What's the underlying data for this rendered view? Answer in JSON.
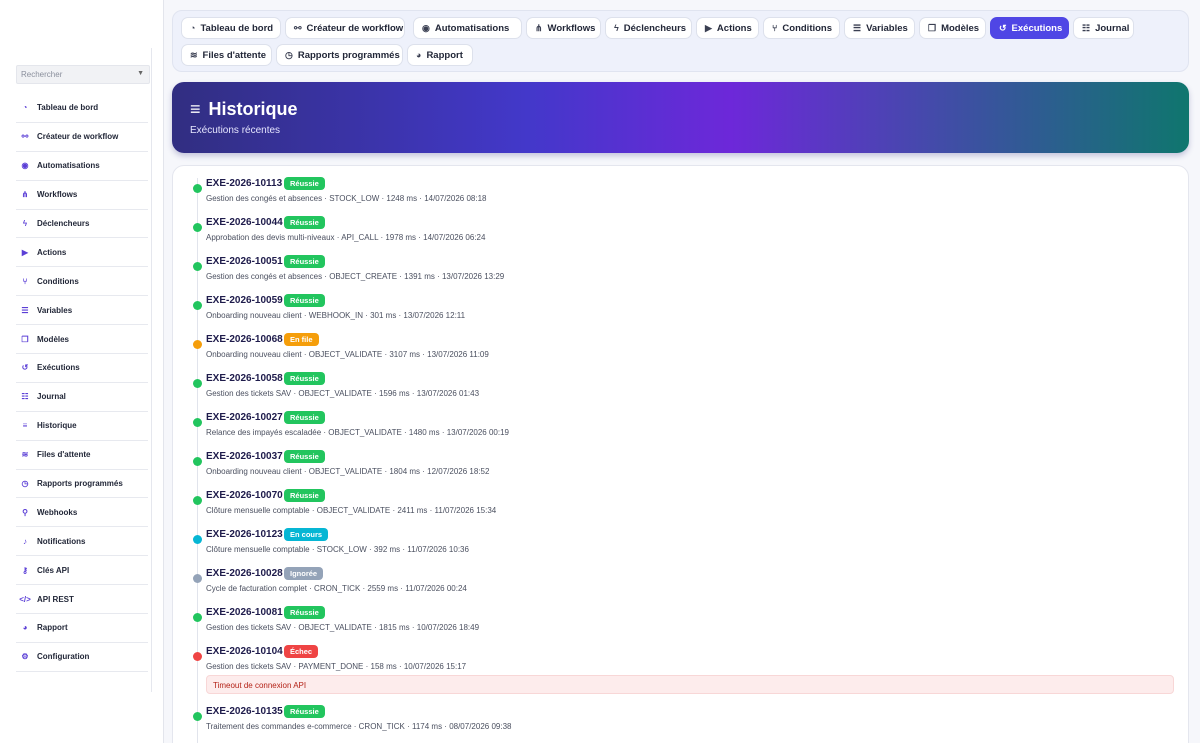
{
  "sidebar": {
    "search_placeholder": "Rechercher",
    "items": [
      {
        "label": "Tableau de bord",
        "icon": "gauge-icon",
        "glyph": "◔"
      },
      {
        "label": "Créateur de workflow",
        "icon": "flow-icon",
        "glyph": "⚯"
      },
      {
        "label": "Automatisations",
        "icon": "robot-icon",
        "glyph": "◉"
      },
      {
        "label": "Workflows",
        "icon": "sitemap-icon",
        "glyph": "⋔"
      },
      {
        "label": "Déclencheurs",
        "icon": "bolt-icon",
        "glyph": "ϟ"
      },
      {
        "label": "Actions",
        "icon": "play-icon",
        "glyph": "▶"
      },
      {
        "label": "Conditions",
        "icon": "branch-icon",
        "glyph": "⑂"
      },
      {
        "label": "Variables",
        "icon": "sliders-icon",
        "glyph": "☰"
      },
      {
        "label": "Modèles",
        "icon": "copy-icon",
        "glyph": "❐"
      },
      {
        "label": "Exécutions",
        "icon": "history-icon",
        "glyph": "↺"
      },
      {
        "label": "Journal",
        "icon": "list-icon",
        "glyph": "☷"
      },
      {
        "label": "Historique",
        "icon": "bars-icon",
        "glyph": "≡"
      },
      {
        "label": "Files d'attente",
        "icon": "layers-icon",
        "glyph": "≋"
      },
      {
        "label": "Rapports programmés",
        "icon": "clock-icon",
        "glyph": "◷"
      },
      {
        "label": "Webhooks",
        "icon": "webhook-icon",
        "glyph": "⚲"
      },
      {
        "label": "Notifications",
        "icon": "bell-icon",
        "glyph": "♪"
      },
      {
        "label": "Clés API",
        "icon": "key-icon",
        "glyph": "⚷"
      },
      {
        "label": "API REST",
        "icon": "code-icon",
        "glyph": "</>"
      },
      {
        "label": "Rapport",
        "icon": "chart-pie-icon",
        "glyph": "◕"
      },
      {
        "label": "Configuration",
        "icon": "gear-icon",
        "glyph": "⚙"
      }
    ]
  },
  "topnav": {
    "row1": [
      {
        "label": "Tableau de bord",
        "icon": "gauge-icon",
        "glyph": "◔",
        "active": false
      },
      {
        "label": "Créateur de workflow",
        "icon": "flow-icon",
        "glyph": "⚯",
        "active": false
      },
      {
        "label": "Automatisations",
        "icon": "robot-icon",
        "glyph": "◉",
        "active": false
      },
      {
        "label": "Workflows",
        "icon": "sitemap-icon",
        "glyph": "⋔",
        "active": false
      },
      {
        "label": "Déclencheurs",
        "icon": "bolt-icon",
        "glyph": "ϟ",
        "active": false
      },
      {
        "label": "Actions",
        "icon": "play-icon",
        "glyph": "▶",
        "active": false
      },
      {
        "label": "Conditions",
        "icon": "branch-icon",
        "glyph": "⑂",
        "active": false
      },
      {
        "label": "Variables",
        "icon": "sliders-icon",
        "glyph": "☰",
        "active": false
      },
      {
        "label": "Modèles",
        "icon": "copy-icon",
        "glyph": "❐",
        "active": false
      },
      {
        "label": "Exécutions",
        "icon": "history-icon",
        "glyph": "↺",
        "active": true
      },
      {
        "label": "Journal",
        "icon": "list-icon",
        "glyph": "☷",
        "active": false
      }
    ],
    "row2": [
      {
        "label": "Files d'attente",
        "icon": "layers-icon",
        "glyph": "≋",
        "active": false
      },
      {
        "label": "Rapports programmés",
        "icon": "clock-icon",
        "glyph": "◷",
        "active": false
      },
      {
        "label": "Rapport",
        "icon": "chart-pie-icon",
        "glyph": "◕",
        "active": false
      }
    ]
  },
  "hero": {
    "title": "Historique",
    "subtitle": "Exécutions récentes"
  },
  "status_colors": {
    "Réussie": "#22c55e",
    "En file": "#f59e0b",
    "En cours": "#06b6d4",
    "Ignorée": "#94a3b8",
    "Échec": "#ef4444"
  },
  "executions": [
    {
      "id": "EXE-2026-10113",
      "status": "Réussie",
      "workflow": "Gestion des congés et absences",
      "trigger": "STOCK_LOW",
      "duration": "1248 ms",
      "date": "14/07/2026 08:18"
    },
    {
      "id": "EXE-2026-10044",
      "status": "Réussie",
      "workflow": "Approbation des devis multi-niveaux",
      "trigger": "API_CALL",
      "duration": "1978 ms",
      "date": "14/07/2026 06:24"
    },
    {
      "id": "EXE-2026-10051",
      "status": "Réussie",
      "workflow": "Gestion des congés et absences",
      "trigger": "OBJECT_CREATE",
      "duration": "1391 ms",
      "date": "13/07/2026 13:29"
    },
    {
      "id": "EXE-2026-10059",
      "status": "Réussie",
      "workflow": "Onboarding nouveau client",
      "trigger": "WEBHOOK_IN",
      "duration": "301 ms",
      "date": "13/07/2026 12:11"
    },
    {
      "id": "EXE-2026-10068",
      "status": "En file",
      "workflow": "Onboarding nouveau client",
      "trigger": "OBJECT_VALIDATE",
      "duration": "3107 ms",
      "date": "13/07/2026 11:09"
    },
    {
      "id": "EXE-2026-10058",
      "status": "Réussie",
      "workflow": "Gestion des tickets SAV",
      "trigger": "OBJECT_VALIDATE",
      "duration": "1596 ms",
      "date": "13/07/2026 01:43"
    },
    {
      "id": "EXE-2026-10027",
      "status": "Réussie",
      "workflow": "Relance des impayés escaladée",
      "trigger": "OBJECT_VALIDATE",
      "duration": "1480 ms",
      "date": "13/07/2026 00:19"
    },
    {
      "id": "EXE-2026-10037",
      "status": "Réussie",
      "workflow": "Onboarding nouveau client",
      "trigger": "OBJECT_VALIDATE",
      "duration": "1804 ms",
      "date": "12/07/2026 18:52"
    },
    {
      "id": "EXE-2026-10070",
      "status": "Réussie",
      "workflow": "Clôture mensuelle comptable",
      "trigger": "OBJECT_VALIDATE",
      "duration": "2411 ms",
      "date": "11/07/2026 15:34"
    },
    {
      "id": "EXE-2026-10123",
      "status": "En cours",
      "workflow": "Clôture mensuelle comptable",
      "trigger": "STOCK_LOW",
      "duration": "392 ms",
      "date": "11/07/2026 10:36"
    },
    {
      "id": "EXE-2026-10028",
      "status": "Ignorée",
      "workflow": "Cycle de facturation complet",
      "trigger": "CRON_TICK",
      "duration": "2559 ms",
      "date": "11/07/2026 00:24"
    },
    {
      "id": "EXE-2026-10081",
      "status": "Réussie",
      "workflow": "Gestion des tickets SAV",
      "trigger": "OBJECT_VALIDATE",
      "duration": "1815 ms",
      "date": "10/07/2026 18:49"
    },
    {
      "id": "EXE-2026-10104",
      "status": "Échec",
      "workflow": "Gestion des tickets SAV",
      "trigger": "PAYMENT_DONE",
      "duration": "158 ms",
      "date": "10/07/2026 15:17",
      "error": "Timeout de connexion API"
    },
    {
      "id": "EXE-2026-10135",
      "status": "Réussie",
      "workflow": "Traitement des commandes e-commerce",
      "trigger": "CRON_TICK",
      "duration": "1174 ms",
      "date": "08/07/2026 09:38"
    }
  ]
}
